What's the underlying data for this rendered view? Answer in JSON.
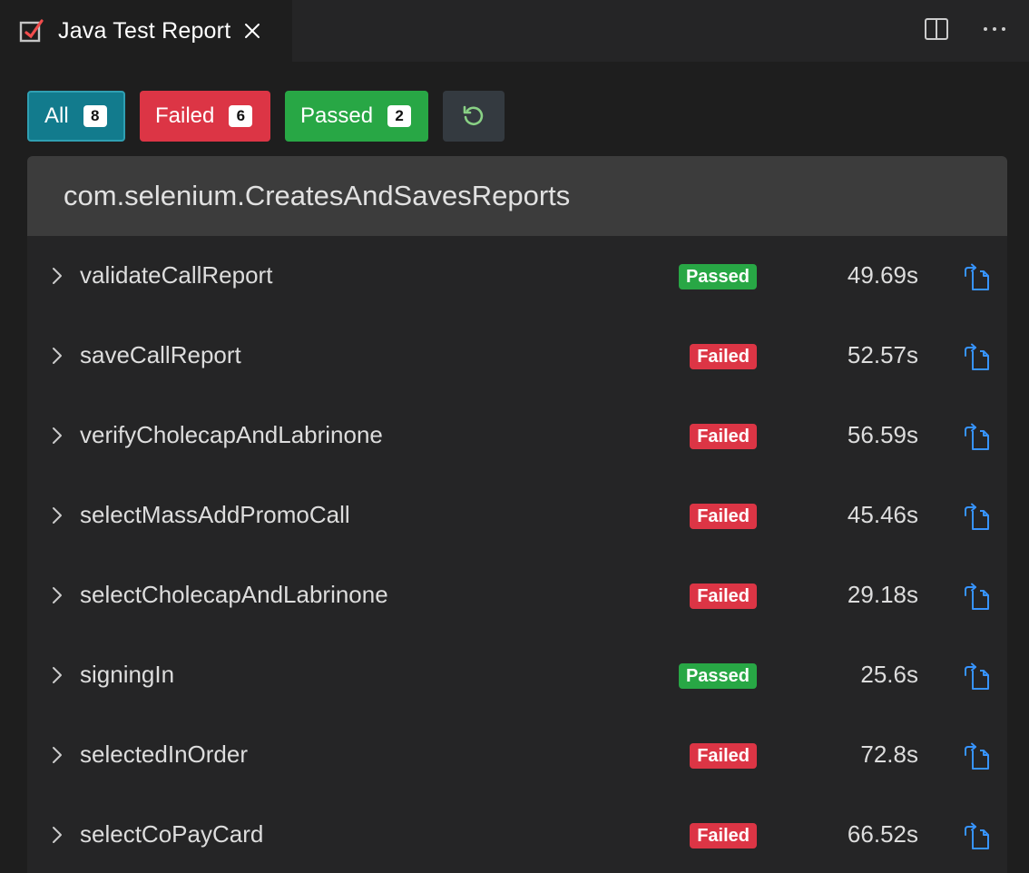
{
  "tab": {
    "title": "Java Test Report",
    "icon": "test-report-icon",
    "close_icon": "close-icon"
  },
  "actions": {
    "split_icon": "split-editor-icon",
    "more_icon": "more-actions-icon"
  },
  "filters": {
    "all": {
      "label": "All",
      "count": "8"
    },
    "failed": {
      "label": "Failed",
      "count": "6"
    },
    "passed": {
      "label": "Passed",
      "count": "2"
    },
    "refresh_icon": "refresh-icon"
  },
  "colors": {
    "all": "#127b8d",
    "failed": "#dc3545",
    "passed": "#28a745",
    "link": "#3794ff"
  },
  "suite": {
    "name": "com.selenium.CreatesAndSavesReports",
    "tests": [
      {
        "name": "validateCallReport",
        "status": "Passed",
        "duration": "49.69s"
      },
      {
        "name": "saveCallReport",
        "status": "Failed",
        "duration": "52.57s"
      },
      {
        "name": "verifyCholecapAndLabrinone",
        "status": "Failed",
        "duration": "56.59s"
      },
      {
        "name": "selectMassAddPromoCall",
        "status": "Failed",
        "duration": "45.46s"
      },
      {
        "name": "selectCholecapAndLabrinone",
        "status": "Failed",
        "duration": "29.18s"
      },
      {
        "name": "signingIn",
        "status": "Passed",
        "duration": "25.6s"
      },
      {
        "name": "selectedInOrder",
        "status": "Failed",
        "duration": "72.8s"
      },
      {
        "name": "selectCoPayCard",
        "status": "Failed",
        "duration": "66.52s"
      }
    ]
  }
}
